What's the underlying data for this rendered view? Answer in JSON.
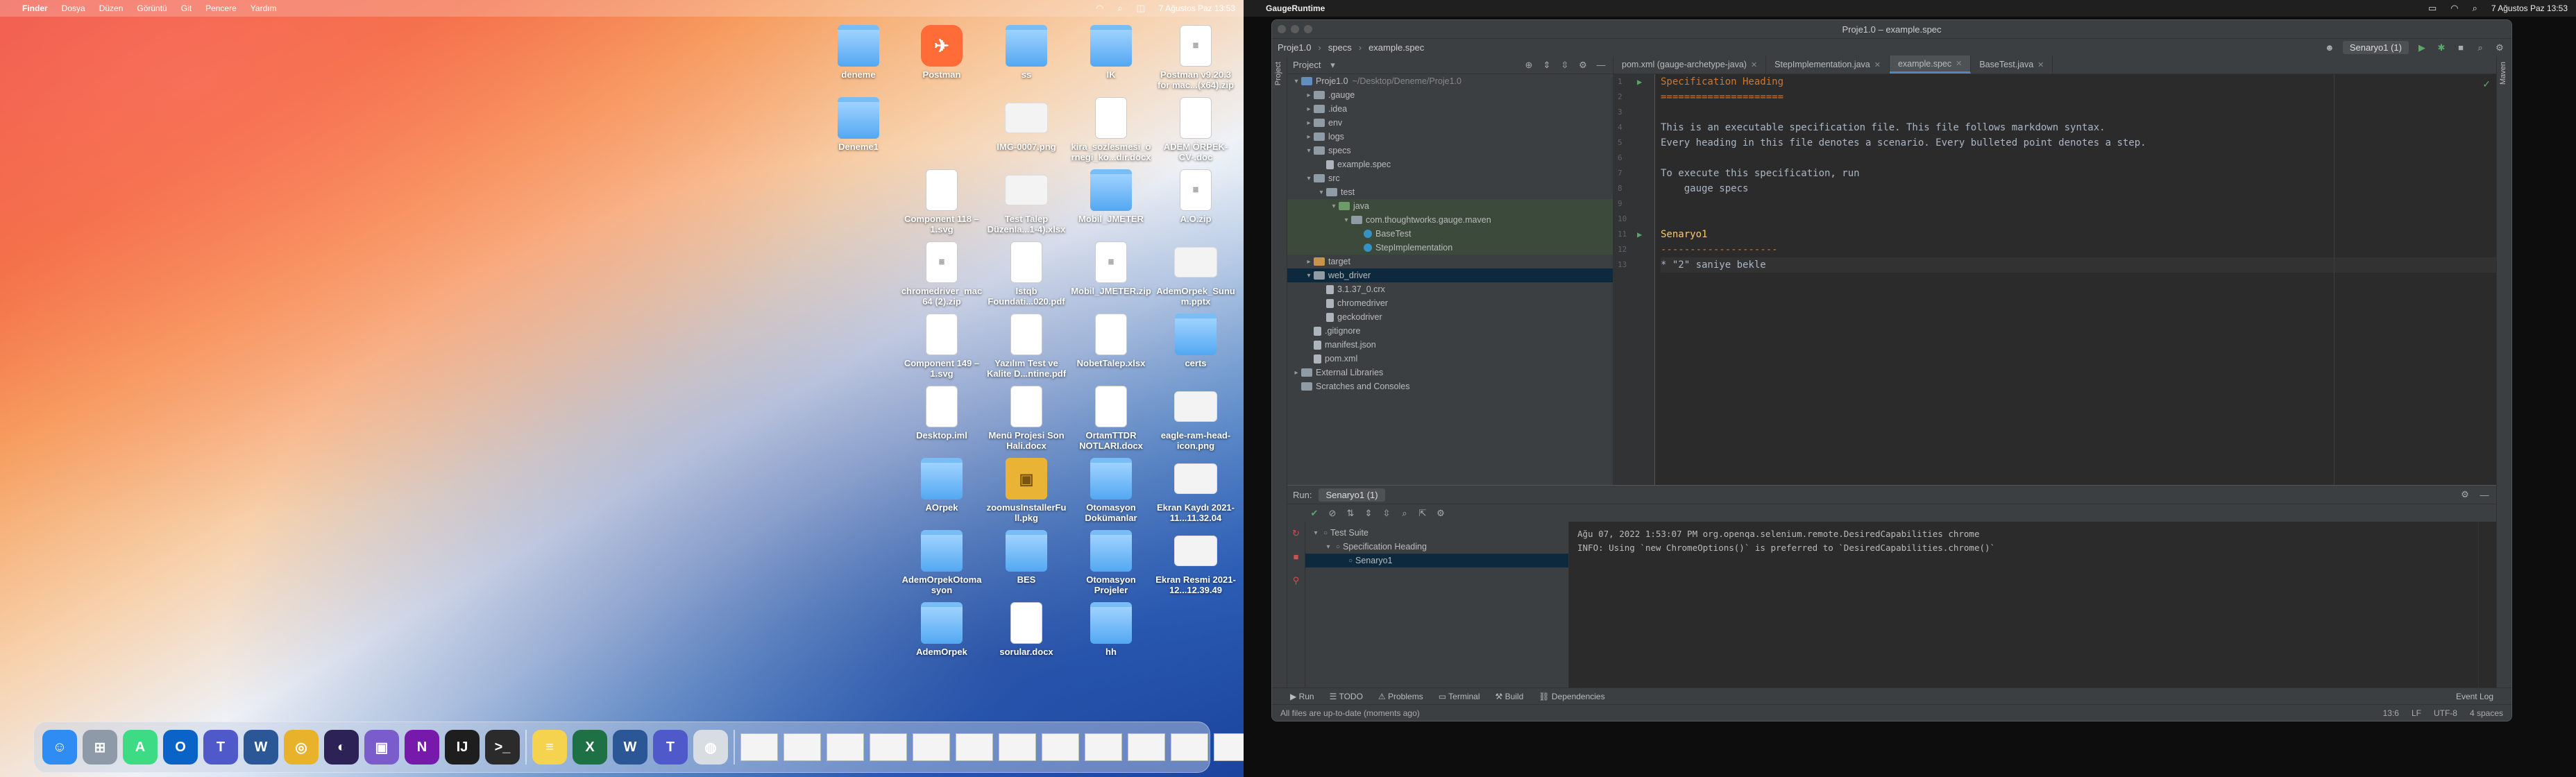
{
  "left_menubar": {
    "apple": "",
    "items": [
      "Finder",
      "Dosya",
      "Düzen",
      "Görüntü",
      "Git",
      "Pencere",
      "Yardım"
    ],
    "clock": "7 Ağustos Paz 13:53"
  },
  "right_menubar": {
    "apple": "",
    "app_name": "GaugeRuntime",
    "clock": "7 Ağustos Paz 13:53"
  },
  "desktop_icons": [
    {
      "label": "deneme",
      "type": "folder"
    },
    {
      "label": "Postman",
      "type": "app"
    },
    {
      "label": "ss",
      "type": "folder"
    },
    {
      "label": "IK",
      "type": "folder"
    },
    {
      "label": "Postman v9.20.3 for mac...(x64).zip",
      "type": "zip"
    },
    {
      "label": "Deneme1",
      "type": "folder"
    },
    {
      "label": "IMG-0007.png",
      "type": "img"
    },
    {
      "label": "kira_sozlesmesi_ornegi_ko...dir.docx",
      "type": "doc"
    },
    {
      "label": "ADEM ÖRPEK-CV-.doc",
      "type": "doc"
    },
    {
      "label": "Component 118 – 1.svg",
      "type": "doc"
    },
    {
      "label": "Test Talep Düzenla...1-4).xlsx",
      "type": "img"
    },
    {
      "label": "Mobil_JMETER",
      "type": "folder"
    },
    {
      "label": "A.O.zip",
      "type": "zip"
    },
    {
      "label": "chromedriver_mac64 (2).zip",
      "type": "zip"
    },
    {
      "label": "Istqb Foundati...020.pdf",
      "type": "doc"
    },
    {
      "label": "Mobil_JMETER.zip",
      "type": "zip"
    },
    {
      "label": "AdemOrpek_Sunum.pptx",
      "type": "img"
    },
    {
      "label": "Component 149 – 1.svg",
      "type": "doc"
    },
    {
      "label": "Yazılım Test ve Kalite D...ntine.pdf",
      "type": "doc"
    },
    {
      "label": "NobetTalep.xlsx",
      "type": "doc"
    },
    {
      "label": "certs",
      "type": "folder"
    },
    {
      "label": "Desktop.iml",
      "type": "doc"
    },
    {
      "label": "Menü Projesi Son Hali.docx",
      "type": "doc"
    },
    {
      "label": "OrtamTTDR NOTLARI.docx",
      "type": "doc"
    },
    {
      "label": "eagle-ram-head-icon.png",
      "type": "img"
    },
    {
      "label": "AOrpek",
      "type": "folder"
    },
    {
      "label": "zoomusInstallerFull.pkg",
      "type": "pkg"
    },
    {
      "label": "Otomasyon Dokümanlar",
      "type": "folder"
    },
    {
      "label": "Ekran Kaydı 2021-11...11.32.04",
      "type": "img"
    },
    {
      "label": "AdemOrpekOtomasyon",
      "type": "folder"
    },
    {
      "label": "BES",
      "type": "folder"
    },
    {
      "label": "Otomasyon Projeler",
      "type": "folder"
    },
    {
      "label": "Ekran Resmi 2021-12...12.39.49",
      "type": "img"
    },
    {
      "label": "AdemOrpek",
      "type": "folder"
    },
    {
      "label": "sorular.docx",
      "type": "doc"
    },
    {
      "label": "hh",
      "type": "folder"
    }
  ],
  "dock_apps": [
    {
      "name": "Finder",
      "color": "#2f8cf2",
      "glyph": "☺"
    },
    {
      "name": "Launchpad",
      "color": "#8e9aa8",
      "glyph": "⊞"
    },
    {
      "name": "Android Studio",
      "color": "#3ddc84",
      "glyph": "A"
    },
    {
      "name": "Outlook",
      "color": "#0a64c8",
      "glyph": "O"
    },
    {
      "name": "Teams",
      "color": "#5059c9",
      "glyph": "T"
    },
    {
      "name": "Word",
      "color": "#2b5797",
      "glyph": "W"
    },
    {
      "name": "Chrome",
      "color": "#e8b32a",
      "glyph": "◎"
    },
    {
      "name": "Eclipse",
      "color": "#2c2255",
      "glyph": "◐"
    },
    {
      "name": "Preview",
      "color": "#7a5ccd",
      "glyph": "▣"
    },
    {
      "name": "OneNote",
      "color": "#7719aa",
      "glyph": "N"
    },
    {
      "name": "IntelliJ IDEA",
      "color": "#1e1e1e",
      "glyph": "IJ"
    },
    {
      "name": "Terminal",
      "color": "#2b2b2b",
      "glyph": ">_"
    },
    {
      "name": "Notes",
      "color": "#f5d34f",
      "glyph": "≡"
    },
    {
      "name": "Excel",
      "color": "#1e7145",
      "glyph": "X"
    },
    {
      "name": "Word 2",
      "color": "#2b5797",
      "glyph": "W"
    },
    {
      "name": "Teams Classic",
      "color": "#5059c9",
      "glyph": "T"
    },
    {
      "name": "Gauge",
      "color": "#d7dde3",
      "glyph": "◍"
    }
  ],
  "ide": {
    "title": "Proje1.0 – example.spec",
    "breadcrumb": [
      "Proje1.0",
      "specs",
      "example.spec"
    ],
    "run_config": "Senaryo1 (1)",
    "project_label": "Project",
    "tree": [
      {
        "label": "Proje1.0",
        "note": "~/Desktop/Deneme/Proje1.0",
        "depth": 0,
        "arrow": "▾",
        "icon": "fold blue",
        "state": ""
      },
      {
        "label": ".gauge",
        "note": "",
        "depth": 1,
        "arrow": "▸",
        "icon": "fold",
        "state": ""
      },
      {
        "label": ".idea",
        "note": "",
        "depth": 1,
        "arrow": "▸",
        "icon": "fold",
        "state": ""
      },
      {
        "label": "env",
        "note": "",
        "depth": 1,
        "arrow": "▸",
        "icon": "fold",
        "state": ""
      },
      {
        "label": "logs",
        "note": "",
        "depth": 1,
        "arrow": "▸",
        "icon": "fold",
        "state": ""
      },
      {
        "label": "specs",
        "note": "",
        "depth": 1,
        "arrow": "▾",
        "icon": "fold",
        "state": ""
      },
      {
        "label": "example.spec",
        "note": "",
        "depth": 2,
        "arrow": "",
        "icon": "file",
        "state": ""
      },
      {
        "label": "src",
        "note": "",
        "depth": 1,
        "arrow": "▾",
        "icon": "fold",
        "state": ""
      },
      {
        "label": "test",
        "note": "",
        "depth": 2,
        "arrow": "▾",
        "icon": "fold",
        "state": ""
      },
      {
        "label": "java",
        "note": "",
        "depth": 3,
        "arrow": "▾",
        "icon": "fold green",
        "state": "hl"
      },
      {
        "label": "com.thoughtworks.gauge.maven",
        "note": "",
        "depth": 4,
        "arrow": "▾",
        "icon": "fold",
        "state": "hl"
      },
      {
        "label": "BaseTest",
        "note": "",
        "depth": 5,
        "arrow": "",
        "icon": "java",
        "state": "hl"
      },
      {
        "label": "StepImplementation",
        "note": "",
        "depth": 5,
        "arrow": "",
        "icon": "java",
        "state": "hl"
      },
      {
        "label": "target",
        "note": "",
        "depth": 1,
        "arrow": "▸",
        "icon": "fold orange",
        "state": ""
      },
      {
        "label": "web_driver",
        "note": "",
        "depth": 1,
        "arrow": "▾",
        "icon": "fold",
        "state": "sel"
      },
      {
        "label": "3.1.37_0.crx",
        "note": "",
        "depth": 2,
        "arrow": "",
        "icon": "file",
        "state": ""
      },
      {
        "label": "chromedriver",
        "note": "",
        "depth": 2,
        "arrow": "",
        "icon": "file",
        "state": ""
      },
      {
        "label": "geckodriver",
        "note": "",
        "depth": 2,
        "arrow": "",
        "icon": "file",
        "state": ""
      },
      {
        "label": ".gitignore",
        "note": "",
        "depth": 1,
        "arrow": "",
        "icon": "file",
        "state": ""
      },
      {
        "label": "manifest.json",
        "note": "",
        "depth": 1,
        "arrow": "",
        "icon": "file",
        "state": ""
      },
      {
        "label": "pom.xml",
        "note": "",
        "depth": 1,
        "arrow": "",
        "icon": "file",
        "state": ""
      },
      {
        "label": "External Libraries",
        "note": "",
        "depth": 0,
        "arrow": "▸",
        "icon": "fold",
        "state": ""
      },
      {
        "label": "Scratches and Consoles",
        "note": "",
        "depth": 0,
        "arrow": "",
        "icon": "fold",
        "state": ""
      }
    ],
    "tabs": [
      {
        "label": "pom.xml (gauge-archetype-java)",
        "active": false
      },
      {
        "label": "StepImplementation.java",
        "active": false
      },
      {
        "label": "example.spec",
        "active": true
      },
      {
        "label": "BaseTest.java",
        "active": false
      }
    ],
    "code_lines": [
      {
        "text": "Specification Heading",
        "kind": "h1"
      },
      {
        "text": "=====================",
        "kind": "h1"
      },
      {
        "text": "",
        "kind": ""
      },
      {
        "text": "This is an executable specification file. This file follows markdown syntax.",
        "kind": ""
      },
      {
        "text": "Every heading in this file denotes a scenario. Every bulleted point denotes a step.",
        "kind": ""
      },
      {
        "text": "",
        "kind": ""
      },
      {
        "text": "To execute this specification, run",
        "kind": ""
      },
      {
        "text": "    gauge specs",
        "kind": ""
      },
      {
        "text": "",
        "kind": ""
      },
      {
        "text": "",
        "kind": ""
      },
      {
        "text": "Senaryo1",
        "kind": "h2"
      },
      {
        "text": "--------------------",
        "kind": "h1"
      },
      {
        "text": "* \"2\" saniye bekle",
        "kind": "step"
      }
    ],
    "run": {
      "label": "Run:",
      "tab": "Senaryo1 (1)",
      "tree": [
        {
          "label": "Test Suite",
          "depth": 0
        },
        {
          "label": "Specification Heading",
          "depth": 1
        },
        {
          "label": "Senaryo1",
          "depth": 2
        }
      ],
      "console": [
        "Ağu 07, 2022 1:53:07 PM org.openqa.selenium.remote.DesiredCapabilities chrome",
        "INFO: Using `new ChromeOptions()` is preferred to `DesiredCapabilities.chrome()`"
      ]
    },
    "bottom_tabs": [
      "Run",
      "TODO",
      "Problems",
      "Terminal",
      "Build",
      "Dependencies"
    ],
    "event_log": "Event Log",
    "status_left": "All files are up-to-date (moments ago)",
    "status_right": [
      "13:6",
      "LF",
      "UTF-8",
      "4 spaces"
    ]
  }
}
